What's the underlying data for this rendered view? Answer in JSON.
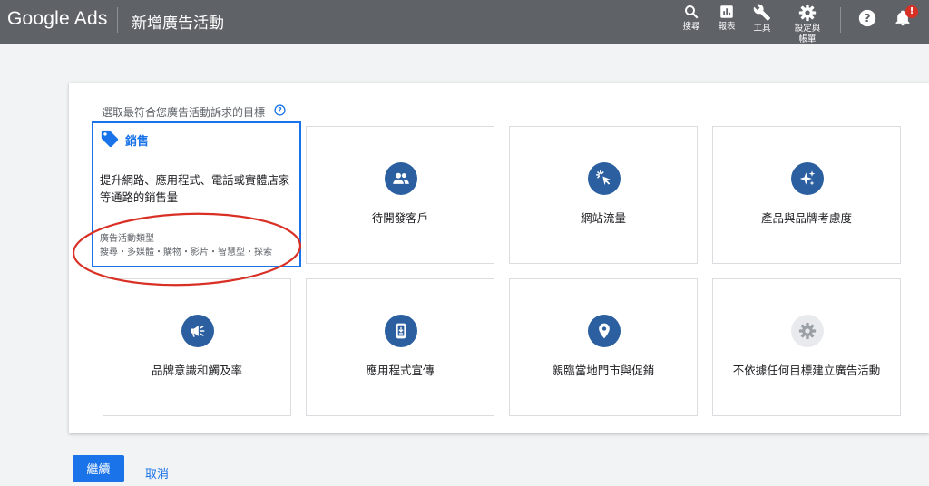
{
  "header": {
    "logo": "Google Ads",
    "title": "新增廣告活動",
    "actions": [
      {
        "label": "搜尋",
        "icon": "search-icon"
      },
      {
        "label": "報表",
        "icon": "reports-icon"
      },
      {
        "label": "工具",
        "icon": "wrench-icon"
      },
      {
        "label": "設定與帳單",
        "icon": "gear-icon"
      }
    ],
    "notification_badge": "!"
  },
  "main": {
    "prompt": "選取最符合您廣告活動訴求的目標",
    "selected_goal": {
      "title": "銷售",
      "description": "提升網路、應用程式、電話或實體店家等通路的銷售量",
      "campaign_type_heading": "廣告活動類型",
      "campaign_types": "搜尋・多媒體・購物・影片・智慧型・探索"
    },
    "goals": [
      {
        "label": "待開發客戶",
        "icon": "people-icon"
      },
      {
        "label": "網站流量",
        "icon": "cursor-click-icon"
      },
      {
        "label": "產品與品牌考慮度",
        "icon": "sparkle-icon"
      },
      {
        "label": "品牌意識和觸及率",
        "icon": "megaphone-icon"
      },
      {
        "label": "應用程式宣傳",
        "icon": "phone-download-icon"
      },
      {
        "label": "親臨當地門市與促銷",
        "icon": "location-pin-icon"
      },
      {
        "label": "不依據任何目標建立廣告活動",
        "icon": "gear-icon"
      }
    ]
  },
  "footer": {
    "continue_label": "繼續",
    "cancel_label": "取消"
  },
  "colors": {
    "header_bg": "#5f6368",
    "accent": "#1a73e8",
    "icon_circle": "#2b5fa0",
    "annotation": "#d93025"
  }
}
